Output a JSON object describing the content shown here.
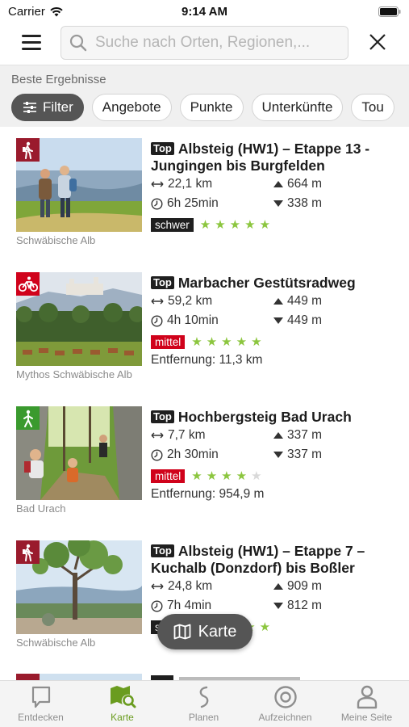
{
  "status_bar": {
    "carrier": "Carrier",
    "time": "9:14 AM"
  },
  "search": {
    "placeholder": "Suche nach Orten, Regionen,..."
  },
  "results": {
    "label": "Beste Ergebnisse",
    "chips": {
      "filter": "Filter",
      "offers": "Angebote",
      "points": "Punkte",
      "accommodations": "Unterkünfte",
      "tours": "Tou"
    }
  },
  "tours": [
    {
      "top": "Top",
      "title": "Albsteig (HW1) – Etappe 13 - Jungingen bis Burgfelden",
      "distance": "22,1 km",
      "duration": "6h 25min",
      "ascent": "664 m",
      "descent": "338 m",
      "difficulty": "schwer",
      "difficulty_color": "#1f1f1f",
      "rating": 5,
      "distance_from": "",
      "region": "Schwäbische Alb",
      "type": "hiking",
      "type_color": "#9a1b2d"
    },
    {
      "top": "Top",
      "title": "Marbacher Gestütsradweg",
      "distance": "59,2 km",
      "duration": "4h 10min",
      "ascent": "449 m",
      "descent": "449 m",
      "difficulty": "mittel",
      "difficulty_color": "#d0021b",
      "rating": 5,
      "distance_from": "Entfernung: 11,3 km",
      "region": "Mythos Schwäbische Alb",
      "type": "cycling",
      "type_color": "#d0021b"
    },
    {
      "top": "Top",
      "title": "Hochbergsteig Bad Urach",
      "distance": "7,7 km",
      "duration": "2h 30min",
      "ascent": "337 m",
      "descent": "337 m",
      "difficulty": "mittel",
      "difficulty_color": "#d0021b",
      "rating": 4,
      "distance_from": "Entfernung: 954,9 m",
      "region": "Bad Urach",
      "type": "walking",
      "type_color": "#3a9a2e"
    },
    {
      "top": "Top",
      "title": "Albsteig (HW1) – Etappe 7 – Kuchalb (Donzdorf) bis Boßler",
      "distance": "24,8 km",
      "duration": "7h 4min",
      "ascent": "909 m",
      "descent": "812 m",
      "difficulty": "schwer",
      "difficulty_color": "#1f1f1f",
      "rating": 5,
      "distance_from": "",
      "region": "Schwäbische Alb",
      "type": "hiking",
      "type_color": "#9a1b2d"
    }
  ],
  "map_button": {
    "label": "Karte"
  },
  "tabs": [
    {
      "label": "Entdecken",
      "icon": "chat-bubble-icon"
    },
    {
      "label": "Karte",
      "icon": "map-search-icon"
    },
    {
      "label": "Planen",
      "icon": "route-icon"
    },
    {
      "label": "Aufzeichnen",
      "icon": "record-icon"
    },
    {
      "label": "Meine Seite",
      "icon": "person-icon"
    }
  ],
  "colors": {
    "accent": "#6a9c1f",
    "star_filled": "#8cc63f",
    "star_empty": "#d9d9d9"
  }
}
